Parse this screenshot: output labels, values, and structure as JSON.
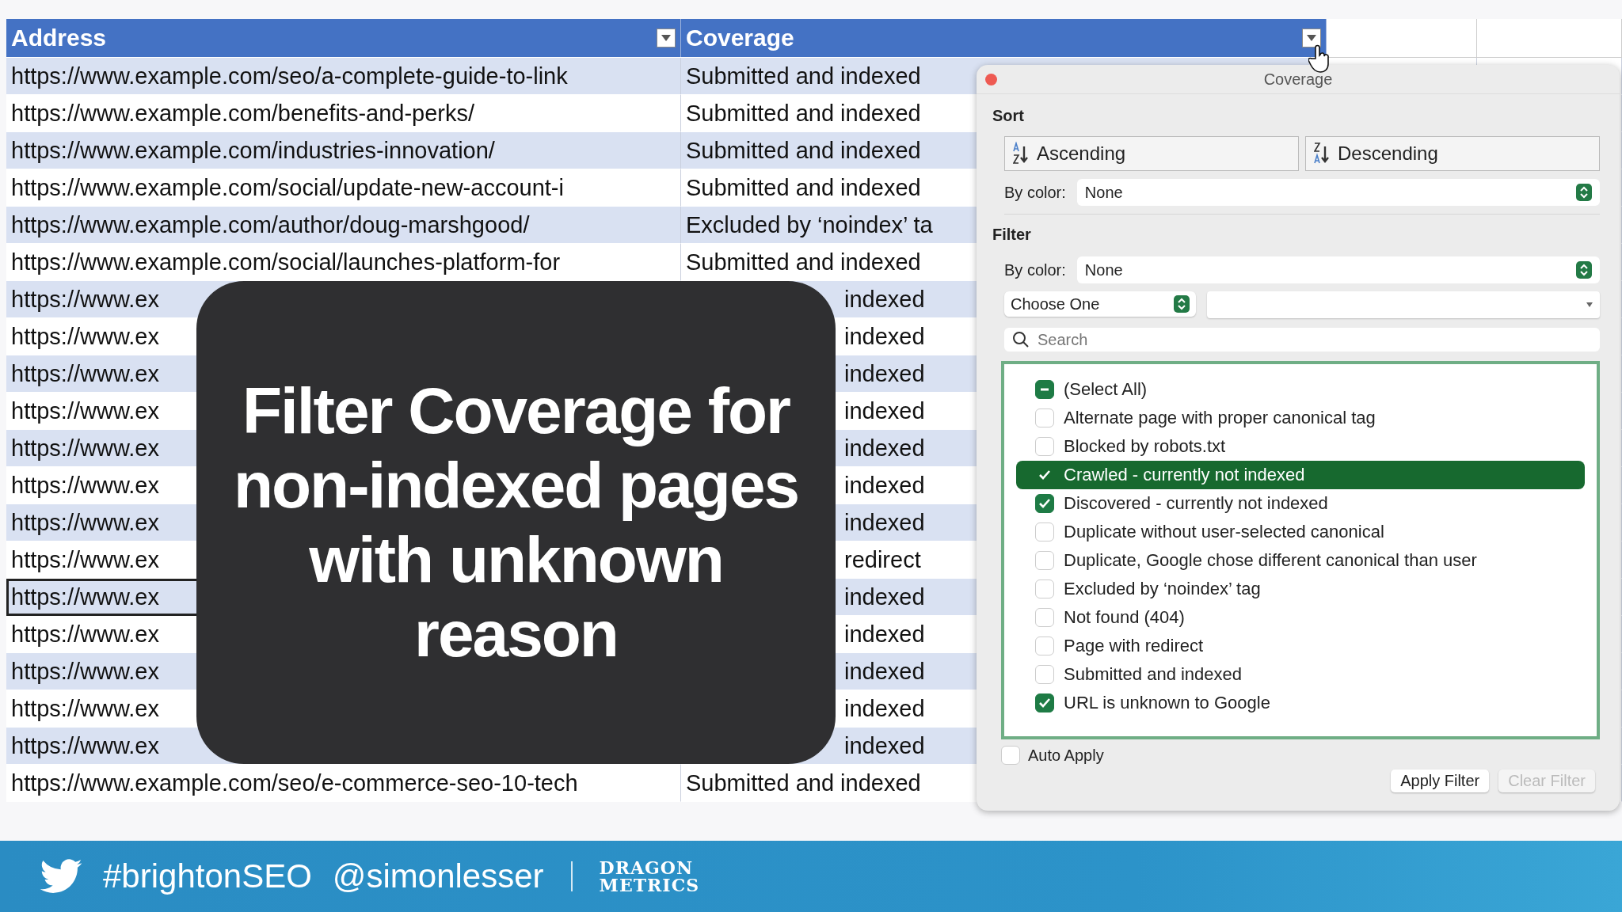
{
  "table": {
    "columns": [
      {
        "label": "Address"
      },
      {
        "label": "Coverage"
      }
    ],
    "rows": [
      {
        "kind": "full",
        "address": "https://www.example.com/seo/a-complete-guide-to-link",
        "coverage": "Submitted and indexed",
        "active": false
      },
      {
        "kind": "full",
        "address": "https://www.example.com/benefits-and-perks/",
        "coverage": "Submitted and indexed",
        "active": false
      },
      {
        "kind": "full",
        "address": "https://www.example.com/industries-innovation/",
        "coverage": "Submitted and indexed",
        "active": false
      },
      {
        "kind": "full",
        "address": "https://www.example.com/social/update-new-account-i",
        "coverage": "Submitted and indexed",
        "active": false
      },
      {
        "kind": "full",
        "address": "https://www.example.com/author/doug-marshgood/",
        "coverage": "Excluded by ‘noindex’ ta",
        "active": false
      },
      {
        "kind": "full",
        "address": "https://www.example.com/social/launches-platform-for",
        "coverage": "Submitted and indexed",
        "active": false
      },
      {
        "kind": "covered",
        "address": "https://www.ex",
        "coverage": "indexed",
        "active": false
      },
      {
        "kind": "covered",
        "address": "https://www.ex",
        "coverage": "indexed",
        "active": false
      },
      {
        "kind": "covered",
        "address": "https://www.ex",
        "coverage": "indexed",
        "active": false
      },
      {
        "kind": "covered",
        "address": "https://www.ex",
        "coverage": "indexed",
        "active": false
      },
      {
        "kind": "covered",
        "address": "https://www.ex",
        "coverage": "indexed",
        "active": false
      },
      {
        "kind": "covered",
        "address": "https://www.ex",
        "coverage": "indexed",
        "active": false
      },
      {
        "kind": "covered",
        "address": "https://www.ex",
        "coverage": "indexed",
        "active": false
      },
      {
        "kind": "covered",
        "address": "https://www.ex",
        "coverage": "redirect",
        "active": false
      },
      {
        "kind": "covered",
        "address": "https://www.ex",
        "coverage": "indexed",
        "active": true
      },
      {
        "kind": "covered",
        "address": "https://www.ex",
        "coverage": "indexed",
        "active": false
      },
      {
        "kind": "covered",
        "address": "https://www.ex",
        "coverage": "indexed",
        "active": false
      },
      {
        "kind": "covered",
        "address": "https://www.ex",
        "coverage": "indexed",
        "active": false
      },
      {
        "kind": "covered",
        "address": "https://www.ex",
        "coverage": "indexed",
        "active": false
      },
      {
        "kind": "full",
        "address": "https://www.example.com/seo/e-commerce-seo-10-tech",
        "coverage": "Submitted and indexed",
        "active": false
      }
    ]
  },
  "caption": [
    "Filter Coverage for",
    "non-indexed pages",
    "with unknown",
    "reason"
  ],
  "popup": {
    "title": "Coverage",
    "sort": {
      "heading": "Sort",
      "ascending": "Ascending",
      "descending": "Descending",
      "by_color_label": "By color:",
      "by_color_value": "None"
    },
    "filter": {
      "heading": "Filter",
      "by_color_label": "By color:",
      "by_color_value": "None",
      "condition": "Choose One",
      "search_placeholder": "Search",
      "select_all": {
        "label": "(Select All)",
        "partial": true
      },
      "items": [
        {
          "label": "Alternate page with proper canonical tag",
          "checked": false,
          "selected": false
        },
        {
          "label": "Blocked by robots.txt",
          "checked": false,
          "selected": false
        },
        {
          "label": "Crawled - currently not indexed",
          "checked": true,
          "selected": true
        },
        {
          "label": "Discovered - currently not indexed",
          "checked": true,
          "selected": false
        },
        {
          "label": "Duplicate without user-selected canonical",
          "checked": false,
          "selected": false
        },
        {
          "label": "Duplicate, Google chose different canonical than user",
          "checked": false,
          "selected": false
        },
        {
          "label": "Excluded by ‘noindex’ tag",
          "checked": false,
          "selected": false
        },
        {
          "label": "Not found (404)",
          "checked": false,
          "selected": false
        },
        {
          "label": "Page with redirect",
          "checked": false,
          "selected": false
        },
        {
          "label": "Submitted and indexed",
          "checked": false,
          "selected": false
        },
        {
          "label": "URL is unknown to Google",
          "checked": true,
          "selected": false
        }
      ]
    },
    "auto_apply": {
      "label": "Auto Apply",
      "checked": false
    },
    "buttons": [
      {
        "label": "Apply Filter",
        "disabled": false
      },
      {
        "label": "Clear Filter",
        "disabled": true
      }
    ]
  },
  "footer": {
    "hashtag": "#brightonSEO",
    "handle": "@simonlesser",
    "logo": [
      "DRAGON",
      "METRICS"
    ]
  }
}
